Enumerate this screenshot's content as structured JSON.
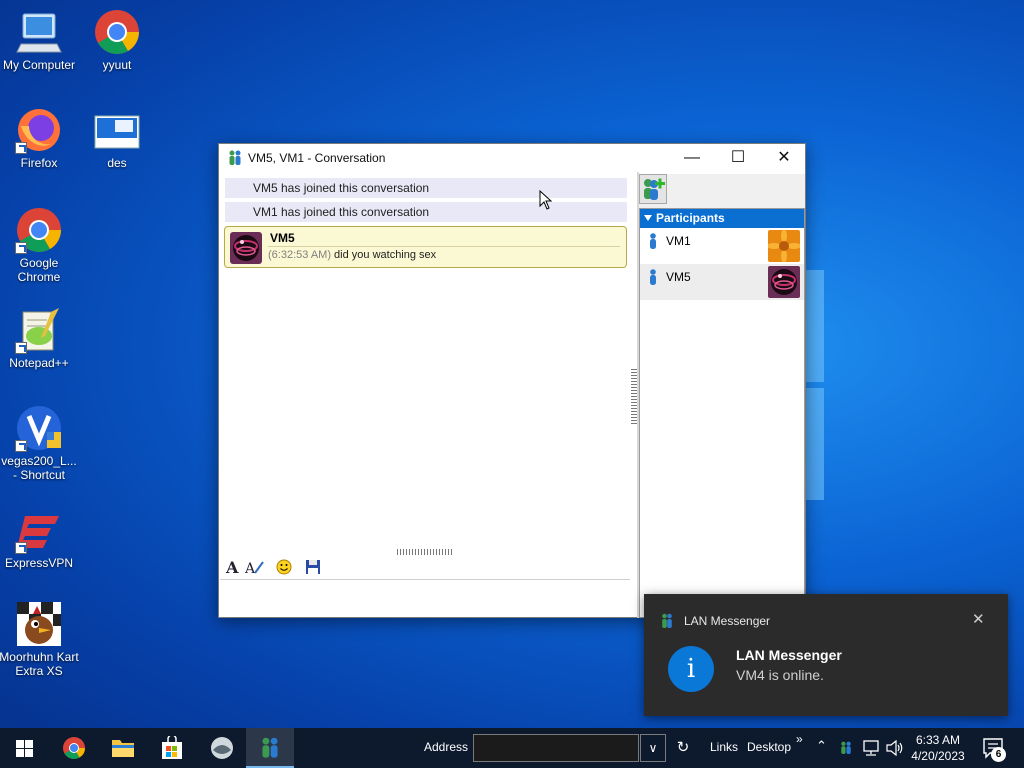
{
  "desktop": {
    "icons": [
      {
        "label": "My Computer"
      },
      {
        "label": "yyuut"
      },
      {
        "label": "Firefox"
      },
      {
        "label": "des"
      },
      {
        "label": "Google Chrome"
      },
      {
        "label": "Notepad++"
      },
      {
        "label": "vegas200_L... - Shortcut"
      },
      {
        "label": "ExpressVPN"
      },
      {
        "label": "Moorhuhn Kart Extra XS"
      }
    ]
  },
  "conversation": {
    "title": "VM5, VM1 - Conversation",
    "system_messages": [
      "VM5 has joined this conversation",
      "VM1 has joined this conversation"
    ],
    "message": {
      "sender": "VM5",
      "time": "(6:32:53 AM)",
      "text": "did you watching sex"
    },
    "participants_header": "Participants",
    "participants": [
      {
        "name": "VM1"
      },
      {
        "name": "VM5"
      }
    ],
    "input_value": ""
  },
  "toast": {
    "app_name": "LAN Messenger",
    "title": "LAN Messenger",
    "body": "VM4 is online."
  },
  "taskbar": {
    "address_label": "Address",
    "address_value": "",
    "links_label": "Links",
    "desktop_label": "Desktop",
    "chevrons": "»",
    "clock_time": "6:33 AM",
    "clock_date": "4/20/2023",
    "notification_count": "6"
  },
  "colors": {
    "accent": "#0a6fd1",
    "bubble_bg": "#fbf9d3",
    "system_msg_bg": "#e8e8f6",
    "toast_bg": "#2b2b2b",
    "taskbar_bg": "#0d1a2e"
  }
}
